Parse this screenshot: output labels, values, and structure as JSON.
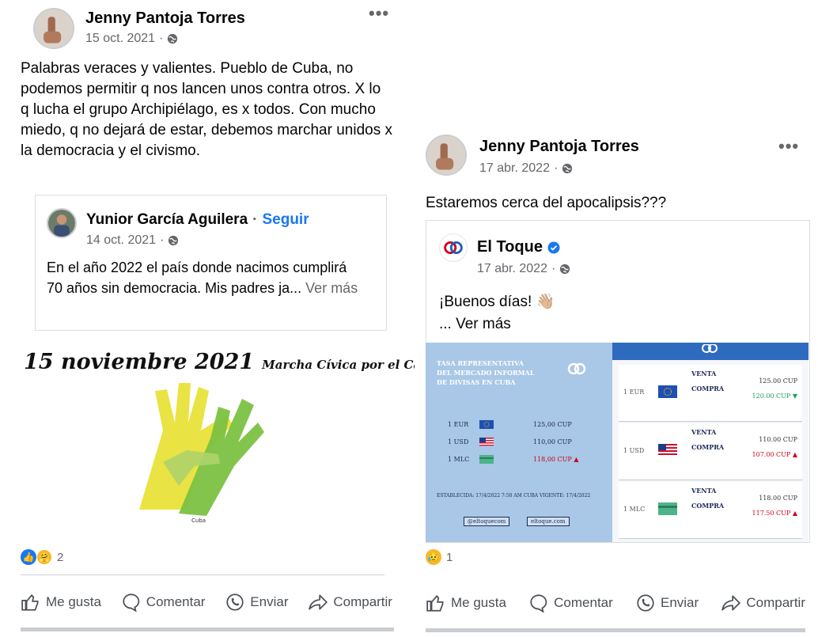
{
  "left_post": {
    "author": "Jenny Pantoja Torres",
    "date": "15 oct. 2021",
    "more": "•••",
    "text": "Palabras veraces y valientes. Pueblo de Cuba, no podemos permitir q nos lancen unos contra otros. X lo q lucha el grupo Archipiélago, es x todos. Con mucho miedo, q no dejará de estar, debemos marchar unidos x la democracia y el civismo.",
    "shared": {
      "author": "Yunior García Aguilera",
      "dot": "·",
      "follow": "Seguir",
      "date": "14 oct. 2021",
      "text": "En el año 2022 el país donde nacimos cumplirá 70 años sin democracia. Mis padres ja...",
      "see_more": "Ver más"
    },
    "image": {
      "date_text": "15 noviembre 2021",
      "subtitle": "Marcha Cívica por el Cambio",
      "logo_text": "Cuba"
    },
    "reaction_count": "2",
    "actions": {
      "like": "Me gusta",
      "comment": "Comentar",
      "send": "Enviar",
      "share": "Compartir"
    }
  },
  "right_post": {
    "author": "Jenny Pantoja Torres",
    "date": "17 abr. 2022",
    "more": "•••",
    "text": "Estaremos cerca del apocalipsis???",
    "shared": {
      "author": "El Toque",
      "date": "17 abr. 2022",
      "text": "¡Buenos días! 👋🏼",
      "see_more": "... Ver más"
    },
    "rates_image": {
      "title_line1": "TASA REPRESENTATIVA",
      "title_line2": "DEL MERCADO INFORMAL",
      "title_line3": "DE DIVISAS EN CUBA",
      "rows": [
        {
          "currency": "1 EUR",
          "value": "125,00 CUP",
          "flag": "eu"
        },
        {
          "currency": "1 USD",
          "value": "110,00 CUP",
          "flag": "us"
        },
        {
          "currency": "1 MLC",
          "value": "118,00 CUP ▲",
          "flag": "mlc"
        }
      ],
      "footer": "ESTABLECIDA: 17/4/2022   7:50 AM  CUBA    VIGENTE: 17/4/2022",
      "tag_left": "@eltoquecom",
      "tag_right": "eltoque.com",
      "detail": [
        {
          "currency": "1 EUR",
          "venta_label": "VENTA",
          "venta": "125.00 CUP",
          "compra_label": "COMPRA",
          "compra": "120.00 CUP ▼",
          "trend": "down"
        },
        {
          "currency": "1 USD",
          "venta_label": "VENTA",
          "venta": "110.00 CUP",
          "compra_label": "COMPRA",
          "compra": "107.00 CUP ▲",
          "trend": "up"
        },
        {
          "currency": "1 MLC",
          "venta_label": "VENTA",
          "venta": "118.00 CUP",
          "compra_label": "COMPRA",
          "compra": "117.50 CUP ▲",
          "trend": "up"
        }
      ]
    },
    "reaction_count": "1",
    "actions": {
      "like": "Me gusta",
      "comment": "Comentar",
      "send": "Enviar",
      "share": "Compartir"
    }
  },
  "colors": {
    "link_blue": "#1877f2",
    "text": "#050505",
    "secondary": "#65676b",
    "rates_blue": "#a9c7e6",
    "green_hand": "#7cc242",
    "yellow_hand": "#e8e23a"
  }
}
